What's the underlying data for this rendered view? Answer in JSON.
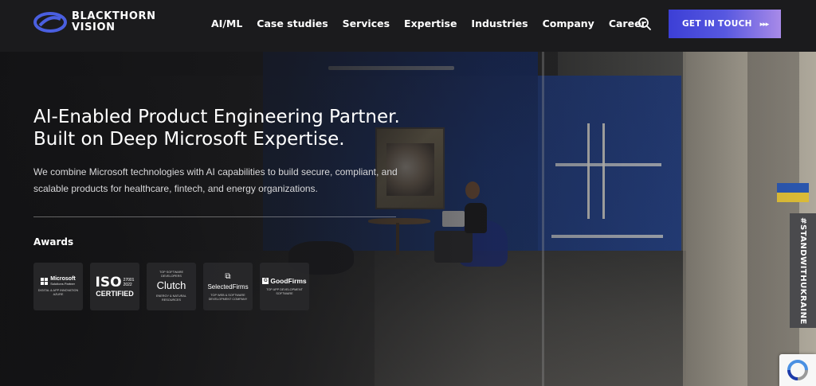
{
  "brand": {
    "name_line1": "BLACKTHORN",
    "name_line2": "VISION",
    "accent": "#4a5fe0"
  },
  "nav": {
    "items": [
      {
        "label": "AI/ML"
      },
      {
        "label": "Case studies"
      },
      {
        "label": "Services"
      },
      {
        "label": "Expertise"
      },
      {
        "label": "Industries"
      },
      {
        "label": "Company"
      },
      {
        "label": "Career"
      }
    ],
    "search_icon": "search-icon",
    "cta_label": "GET IN TOUCH",
    "cta_arrows": "▸▸▸"
  },
  "hero": {
    "headline_line1": "AI-Enabled Product Engineering Partner.",
    "headline_line2": "Built on Deep Microsoft Expertise.",
    "subcopy": "We combine Microsoft technologies with AI capabilities to build secure, compliant, and scalable products for healthcare, fintech, and energy organizations."
  },
  "awards": {
    "title": "Awards",
    "microsoft": {
      "brand": "Microsoft",
      "sub": "Solutions Partner",
      "caption": "DIGITAL & APP INNOVATION AZURE"
    },
    "iso": {
      "big": "ISO",
      "num1": "27001",
      "num2": "2022",
      "caption": "CERTIFIED"
    },
    "clutch": {
      "top": "TOP SOFTWARE DEVELOPERS",
      "word": "Clutch",
      "caption": "ENERGY & NATURAL RESOURCES"
    },
    "selectedfirms": {
      "word": "SelectedFirms",
      "caption": "TOP WEB & SOFTWARE DEVELOPMENT COMPANY"
    },
    "goodfirms": {
      "word": "GoodFirms",
      "caption": "TOP APP DEVELOPMENT SOFTWARE"
    }
  },
  "side_tab": {
    "label": "#STANDWITHUKRAINE"
  }
}
